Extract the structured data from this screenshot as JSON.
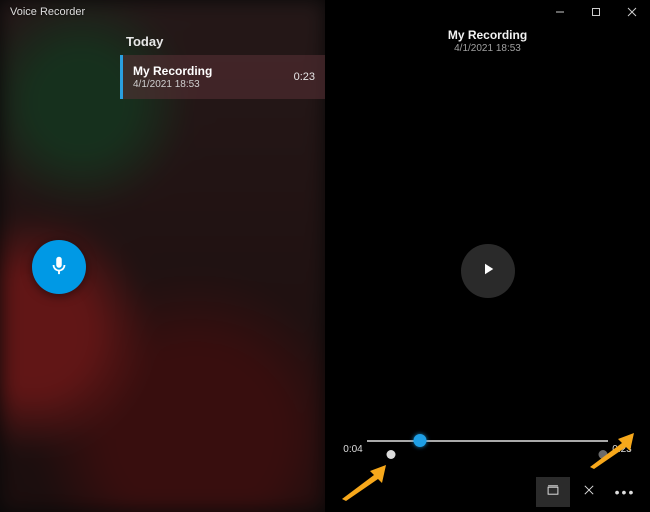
{
  "app": {
    "title": "Voice Recorder"
  },
  "colors": {
    "accent": "#0099e5",
    "playhead": "#1e9fe6",
    "annotation": "#f7a81b"
  },
  "list": {
    "header": "Today",
    "items": [
      {
        "name": "My Recording",
        "date": "4/1/2021 18:53",
        "duration": "0:23"
      }
    ]
  },
  "current": {
    "name": "My Recording",
    "date": "4/1/2021 18:53",
    "elapsed": "0:04",
    "total": "0:23",
    "playhead_percent": 22,
    "markers_percent": [
      10,
      98
    ],
    "marker_dim_index": 1
  },
  "icons": {
    "record": "microphone-icon",
    "play": "play-icon",
    "trim": "trim-icon",
    "delete": "close-icon",
    "more": "more-icon",
    "minimize": "minimize-icon",
    "maximize": "maximize-icon",
    "close": "close-icon"
  }
}
